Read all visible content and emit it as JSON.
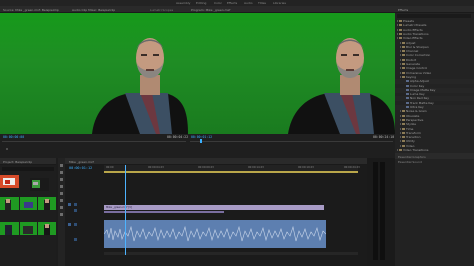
{
  "menu": {
    "items": [
      "Assembly",
      "Editing",
      "Color",
      "Effects",
      "Audio",
      "Titles",
      "Libraries"
    ]
  },
  "source_monitor": {
    "tabs": [
      "Source: Mike _green.mxf: Beispielclip",
      "Audio Clip Mixer: Beispielclip",
      "Lumetri Scopes"
    ],
    "timecode_left": "00:00:00:00",
    "timecode_right": "00:00:04:22"
  },
  "program_monitor": {
    "tab": "Program: Mike _green.mxf",
    "timecode_left": "00:00:01:12",
    "timecode_right": "00:00:24:10"
  },
  "effects_panel": {
    "title": "Effects",
    "items": [
      {
        "label": "Presets",
        "kind": "folder"
      },
      {
        "label": "Lumetri Presets",
        "kind": "folder"
      },
      {
        "label": "Audio Effects",
        "kind": "folder"
      },
      {
        "label": "Audio Transitions",
        "kind": "folder"
      },
      {
        "label": "Video Effects",
        "kind": "folder"
      },
      {
        "label": "Adjust",
        "kind": "folder"
      },
      {
        "label": "Blur & Sharpen",
        "kind": "folder"
      },
      {
        "label": "Channel",
        "kind": "folder"
      },
      {
        "label": "Color Correction",
        "kind": "folder"
      },
      {
        "label": "Distort",
        "kind": "folder"
      },
      {
        "label": "Generate",
        "kind": "folder"
      },
      {
        "label": "Image Control",
        "kind": "folder"
      },
      {
        "label": "Immersive Video",
        "kind": "folder"
      },
      {
        "label": "Keying",
        "kind": "folder-open"
      },
      {
        "label": "Alpha Adjust",
        "kind": "effect"
      },
      {
        "label": "Color Key",
        "kind": "effect"
      },
      {
        "label": "Image Matte Key",
        "kind": "effect"
      },
      {
        "label": "Luma Key",
        "kind": "effect"
      },
      {
        "label": "Non Red Key",
        "kind": "effect"
      },
      {
        "label": "Track Matte Key",
        "kind": "effect"
      },
      {
        "label": "Ultra Key",
        "kind": "effect"
      },
      {
        "label": "Noise & Grain",
        "kind": "folder"
      },
      {
        "label": "Obsolete",
        "kind": "folder"
      },
      {
        "label": "Perspective",
        "kind": "folder"
      },
      {
        "label": "Stylize",
        "kind": "folder"
      },
      {
        "label": "Time",
        "kind": "folder"
      },
      {
        "label": "Transform",
        "kind": "folder"
      },
      {
        "label": "Transition",
        "kind": "folder"
      },
      {
        "label": "Utility",
        "kind": "folder"
      },
      {
        "label": "Video",
        "kind": "folder"
      },
      {
        "label": "Video Transitions",
        "kind": "folder"
      }
    ],
    "sub_panels": [
      "Essential Graphics",
      "Essential Sound"
    ]
  },
  "project_panel": {
    "title": "Project: Beispielclip"
  },
  "timeline": {
    "tab": "Mike _green.mxf",
    "timecode": "00:00:01:12",
    "ruler": [
      "00:00",
      "00:00:04:23",
      "00:00:09:23",
      "00:00:14:23",
      "00:00:19:23",
      "00:00:24:23"
    ],
    "video_clip_label": "Mike _green.mxf [V]",
    "tracks": [
      "V3",
      "V2",
      "V1",
      "A1",
      "A2",
      "A3"
    ]
  },
  "colors": {
    "accent_blue": "#3bb0ff",
    "clip_video": "#a89bc6",
    "clip_audio": "#5d7fb0",
    "playhead": "#4db3ff",
    "greenscreen": "#1f9a22"
  }
}
